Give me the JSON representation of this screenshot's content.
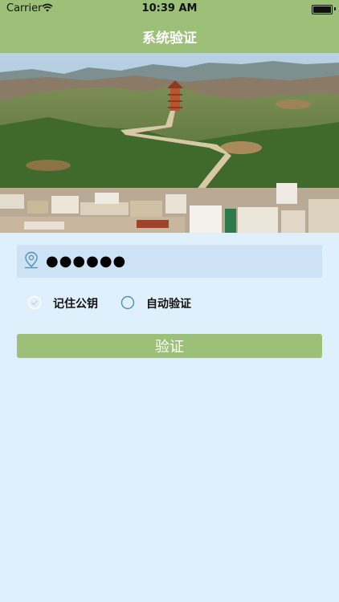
{
  "status_bar": {
    "carrier": "Carrier",
    "time": "10:39 AM"
  },
  "nav": {
    "title": "系统验证"
  },
  "form": {
    "password_value": "●●●●●●",
    "remember_label": "记住公钥",
    "auto_verify_label": "自动验证",
    "verify_label": "验证"
  },
  "colors": {
    "header": "#9cc077",
    "background": "#dff0fc",
    "field": "#cde2f5",
    "accent_icon": "#4f8fbd"
  }
}
